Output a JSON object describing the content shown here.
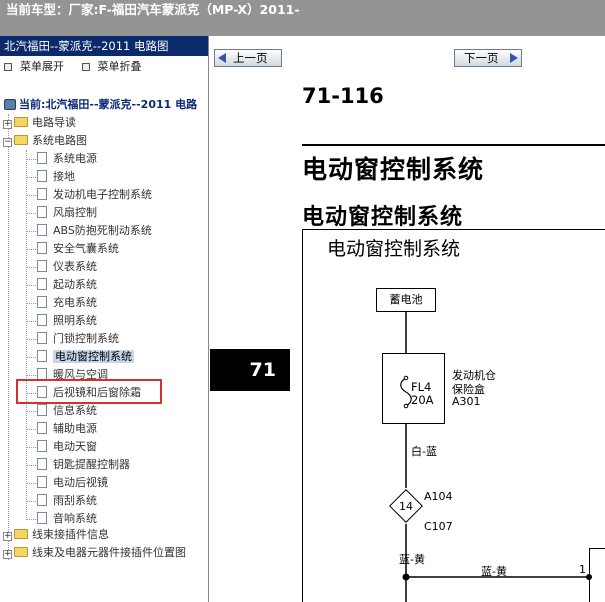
{
  "topbar": {
    "label": "当前车型：",
    "value": "厂家:F-福田汽车蒙派克（MP-X）2011-"
  },
  "left": {
    "title": "北汽福田--蒙派克--2011 电路图",
    "expand_label": "菜单展开",
    "collapse_label": "菜单折叠",
    "current": "当前:北汽福田--蒙派克--2011 电路",
    "tree": [
      {
        "label": "电路导读",
        "type": "folder",
        "state": "collapsed"
      },
      {
        "label": "系统电路图",
        "type": "folder",
        "state": "expanded",
        "children": [
          "系统电源",
          "接地",
          "发动机电子控制系统",
          "风扇控制",
          "ABS防抱死制动系统",
          "安全气囊系统",
          "仪表系统",
          "起动系统",
          "充电系统",
          "照明系统",
          "门锁控制系统",
          "电动窗控制系统",
          "暖风与空调",
          "后视镜和后窗除霜",
          "信息系统",
          "辅助电源",
          "电动天窗",
          "钥匙提醒控制器",
          "电动后视镜",
          "雨刮系统",
          "音响系统"
        ]
      },
      {
        "label": "线束接插件信息",
        "type": "folder",
        "state": "collapsed"
      },
      {
        "label": "线束及电器元器件接插件位置图",
        "type": "folder",
        "state": "collapsed"
      }
    ],
    "selected": "电动窗控制系统"
  },
  "viewer": {
    "prev_label": "上一页",
    "next_label": "下一页",
    "page_number": "71-116",
    "title": "电动窗控制系统",
    "subtitle": "电动窗控制系统",
    "chapter_tab": "71",
    "diagram": {
      "title": "电动窗控制系统",
      "battery": "蓄电池",
      "fuse_name": "FL4",
      "fuse_amp": "20A",
      "fuse_box_line1": "发动机仓",
      "fuse_box_line2": "保险盒",
      "fuse_box_code": "A301",
      "wire_color_1": "白-蓝",
      "connector_top": "A104",
      "connector_num": "14",
      "connector_bottom": "C107",
      "wire_color_2": "蓝-黄",
      "wire_color_3": "蓝-黄",
      "pin": "1"
    }
  }
}
